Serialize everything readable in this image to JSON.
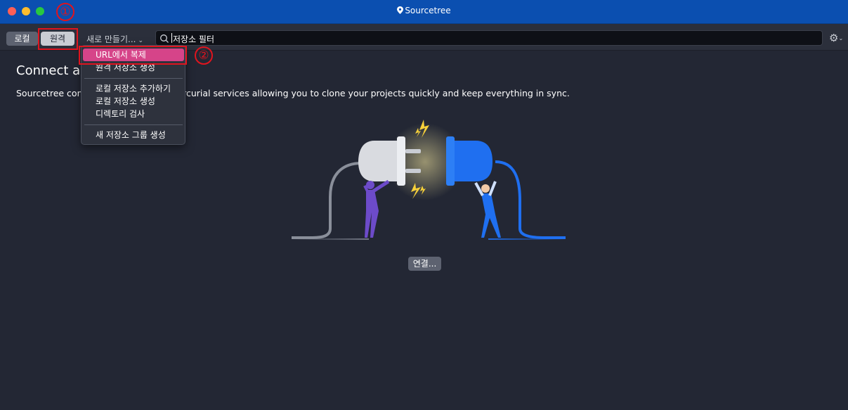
{
  "window": {
    "title": "Sourcetree"
  },
  "toolbar": {
    "local_label": "로컬",
    "remote_label": "원격",
    "new_menu_label": "새로 만들기...",
    "search_value": "저장소 필터"
  },
  "main": {
    "heading": "Connect a h",
    "description": "Sourcetree con",
    "description_tail": "it or Mercurial services allowing you to clone your projects quickly and keep everything in sync.",
    "connect_button": "연결..."
  },
  "dropdown": {
    "items": [
      {
        "label": "URL에서 복제",
        "highlighted": true
      },
      {
        "label": "원격 저장소 생성"
      },
      {
        "label": "로컬 저장소 추가하기"
      },
      {
        "label": "로컬 저장소 생성"
      },
      {
        "label": "디렉토리 검사"
      },
      {
        "label": "새 저장소 그룹 생성"
      }
    ]
  },
  "annotations": {
    "step1": "①",
    "step2": "②"
  },
  "colors": {
    "titlebar": "#0b4fb0",
    "background": "#232734",
    "highlight": "#d64489",
    "annotation": "#e0141e",
    "plug_left": "#d9dbe0",
    "plug_right": "#1f6ff0",
    "spark": "#f6d03a"
  },
  "icons": [
    "location-pin-icon",
    "search-icon",
    "gear-icon",
    "chevron-down-icon"
  ]
}
